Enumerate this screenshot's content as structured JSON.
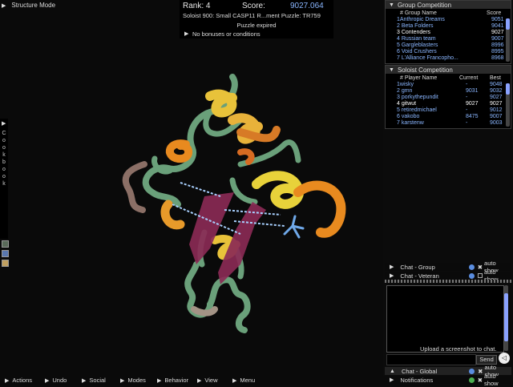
{
  "mode": {
    "label": "Structure Mode"
  },
  "score_panel": {
    "rank": "Rank: 4",
    "score_label": "Score:",
    "score_value": "9027.064",
    "puzzle_title": "Soloist    900: Small CASP11 R...ment Puzzle: TR759",
    "status": "Puzzle expired",
    "bonuses": "No bonuses or conditions"
  },
  "cookbook": {
    "label": "Cookbook"
  },
  "group_competition": {
    "title": "Group Competition",
    "headers": {
      "name": "# Group Name",
      "score": "Score"
    },
    "rows": [
      {
        "name": "1Anthropic Dreams",
        "score": "9051"
      },
      {
        "name": "2 Beta Folders",
        "score": "9041"
      },
      {
        "name": "3 Contenders",
        "score": "9027"
      },
      {
        "name": "4 Russian team",
        "score": "9007"
      },
      {
        "name": "5 Gargleblasters",
        "score": "8996"
      },
      {
        "name": "6 Void Crushers",
        "score": "8995"
      },
      {
        "name": "7 L'Alliance Francopho...",
        "score": "8968"
      }
    ]
  },
  "soloist_competition": {
    "title": "Soloist Competition",
    "headers": {
      "name": "# Player Name",
      "current": "Current",
      "best": "Best"
    },
    "rows": [
      {
        "name": "1wisky",
        "current": "-",
        "best": "9048"
      },
      {
        "name": "2 gmn",
        "current": "9031",
        "best": "9032"
      },
      {
        "name": "3 porkythepundit",
        "current": "-",
        "best": "9027"
      },
      {
        "name": "4 gitwut",
        "current": "9027",
        "best": "9027"
      },
      {
        "name": "5 retiredmichael",
        "current": "-",
        "best": "9012"
      },
      {
        "name": "6 vakobo",
        "current": "8475",
        "best": "9007"
      },
      {
        "name": "7 karstenw",
        "current": "-",
        "best": "9003"
      }
    ]
  },
  "chat": {
    "group": "Chat - Group",
    "veteran": "Chat - Veteran",
    "global": "Chat - Global",
    "notifications": "Notifications",
    "auto_show": "auto show",
    "upload": "Upload a screenshot to chat.",
    "send": "Send"
  },
  "menu": {
    "items": [
      "Actions",
      "Undo",
      "Social",
      "Modes",
      "Behavior",
      "View",
      "Menu"
    ]
  },
  "colors": {
    "helix_yellow": "#e8d23a",
    "helix_orange": "#e88a1f",
    "sheet_purple": "#8a2a55",
    "loop_green": "#6aa07a",
    "hbond_blue": "#a8d0ff",
    "score_blue": "#8ab6ff"
  }
}
